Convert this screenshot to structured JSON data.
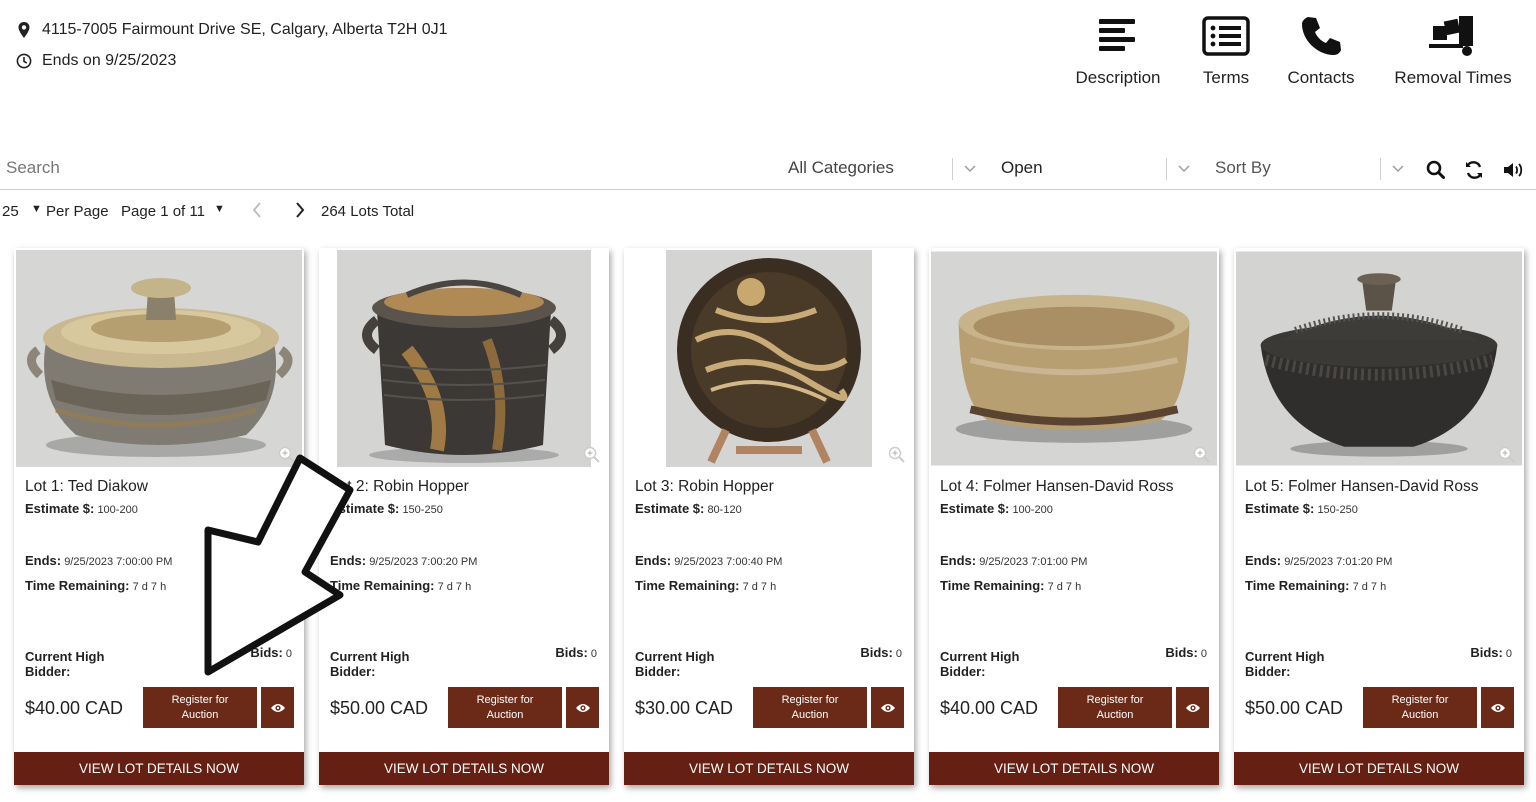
{
  "header": {
    "address": "4115-7005 Fairmount Drive SE, Calgary, Alberta T2H 0J1",
    "ends": "Ends on 9/25/2023",
    "nav": {
      "description": "Description",
      "terms": "Terms",
      "contacts": "Contacts",
      "removal_times": "Removal Times"
    }
  },
  "filters": {
    "search_placeholder": "Search",
    "category": "All Categories",
    "status": "Open",
    "sort": "Sort By"
  },
  "pager": {
    "per_page_value": "25",
    "per_page_label": "Per Page",
    "page_label": "Page 1 of 11",
    "total": "264 Lots Total"
  },
  "labels": {
    "estimate": "Estimate $:",
    "ends": "Ends:",
    "time_remaining": "Time Remaining:",
    "current_high_bidder": "Current High Bidder:",
    "bids": "Bids:",
    "register": "Register for Auction",
    "view_details": "VIEW LOT DETAILS NOW"
  },
  "lots": [
    {
      "title": "Lot 1:  Ted Diakow",
      "estimate": "100-200",
      "ends": "9/25/2023 7:00:00 PM",
      "remaining": "7 d   7 h",
      "bids": "0",
      "price": "$40.00 CAD"
    },
    {
      "title": "Lot 2:  Robin Hopper",
      "estimate": "150-250",
      "ends": "9/25/2023 7:00:20 PM",
      "remaining": "7 d   7 h",
      "bids": "0",
      "price": "$50.00 CAD"
    },
    {
      "title": "Lot 3:  Robin Hopper",
      "estimate": "80-120",
      "ends": "9/25/2023 7:00:40 PM",
      "remaining": "7 d   7 h",
      "bids": "0",
      "price": "$30.00 CAD"
    },
    {
      "title": "Lot 4:  Folmer Hansen-David Ross",
      "estimate": "100-200",
      "ends": "9/25/2023 7:01:00 PM",
      "remaining": "7 d   7 h",
      "bids": "0",
      "price": "$40.00 CAD"
    },
    {
      "title": "Lot 5:  Folmer Hansen-David Ross",
      "estimate": "150-250",
      "ends": "9/25/2023 7:01:20 PM",
      "remaining": "7 d   7 h",
      "bids": "0",
      "price": "$50.00 CAD"
    }
  ],
  "colors": {
    "brand": "#6b2a18",
    "details_bar": "#651f13"
  },
  "icons": [
    "map-pin-icon",
    "clock-icon",
    "description-icon",
    "terms-icon",
    "phone-icon",
    "dolly-icon",
    "search-icon",
    "refresh-icon",
    "speaker-icon",
    "zoom-icon",
    "eye-icon"
  ]
}
